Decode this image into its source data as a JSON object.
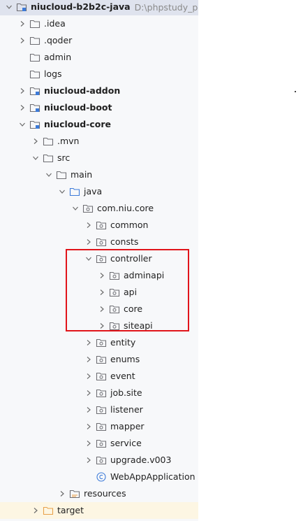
{
  "tree": {
    "items": [
      {
        "label": "niucloud-b2b2c-java",
        "path": "D:\\phpstudy_pro\\W",
        "bold": true,
        "expanded": true,
        "icon": "module-folder",
        "indent": 0,
        "root": true
      },
      {
        "label": ".idea",
        "expanded": false,
        "icon": "folder",
        "indent": 1
      },
      {
        "label": ".qoder",
        "expanded": false,
        "icon": "folder",
        "indent": 1
      },
      {
        "label": "admin",
        "expanded": null,
        "icon": "folder",
        "indent": 1
      },
      {
        "label": "logs",
        "expanded": null,
        "icon": "folder",
        "indent": 1
      },
      {
        "label": "niucloud-addon",
        "bold": true,
        "expanded": false,
        "icon": "module-folder",
        "indent": 1
      },
      {
        "label": "niucloud-boot",
        "bold": true,
        "expanded": false,
        "icon": "module-folder",
        "indent": 1
      },
      {
        "label": "niucloud-core",
        "bold": true,
        "expanded": true,
        "icon": "module-folder",
        "indent": 1
      },
      {
        "label": ".mvn",
        "expanded": false,
        "icon": "folder",
        "indent": 2
      },
      {
        "label": "src",
        "expanded": true,
        "icon": "folder",
        "indent": 2
      },
      {
        "label": "main",
        "expanded": true,
        "icon": "folder",
        "indent": 3
      },
      {
        "label": "java",
        "expanded": true,
        "icon": "source-folder",
        "indent": 4
      },
      {
        "label": "com.niu.core",
        "expanded": true,
        "icon": "package",
        "indent": 5
      },
      {
        "label": "common",
        "expanded": false,
        "icon": "package",
        "indent": 6
      },
      {
        "label": "consts",
        "expanded": false,
        "icon": "package",
        "indent": 6
      },
      {
        "label": "controller",
        "expanded": true,
        "icon": "package",
        "indent": 6
      },
      {
        "label": "adminapi",
        "expanded": false,
        "icon": "package",
        "indent": 7
      },
      {
        "label": "api",
        "expanded": false,
        "icon": "package",
        "indent": 7
      },
      {
        "label": "core",
        "expanded": false,
        "icon": "package",
        "indent": 7
      },
      {
        "label": "siteapi",
        "expanded": false,
        "icon": "package",
        "indent": 7
      },
      {
        "label": "entity",
        "expanded": false,
        "icon": "package",
        "indent": 6
      },
      {
        "label": "enums",
        "expanded": false,
        "icon": "package",
        "indent": 6
      },
      {
        "label": "event",
        "expanded": false,
        "icon": "package",
        "indent": 6
      },
      {
        "label": "job.site",
        "expanded": false,
        "icon": "package",
        "indent": 6
      },
      {
        "label": "listener",
        "expanded": false,
        "icon": "package",
        "indent": 6
      },
      {
        "label": "mapper",
        "expanded": false,
        "icon": "package",
        "indent": 6
      },
      {
        "label": "service",
        "expanded": false,
        "icon": "package",
        "indent": 6
      },
      {
        "label": "upgrade.v003",
        "expanded": false,
        "icon": "package",
        "indent": 6
      },
      {
        "label": "WebAppApplication",
        "expanded": null,
        "icon": "class",
        "indent": 6
      },
      {
        "label": "resources",
        "expanded": false,
        "icon": "resources-folder",
        "indent": 4
      },
      {
        "label": "target",
        "expanded": false,
        "icon": "excluded-folder",
        "indent": 2,
        "target": true
      }
    ]
  },
  "colors": {
    "folder_stroke": "#6e6e73",
    "source_folder": "#3d7bd9",
    "excluded_folder": "#e8a04a",
    "class_icon": "#3d7bd9",
    "highlight": "#e1141a"
  }
}
